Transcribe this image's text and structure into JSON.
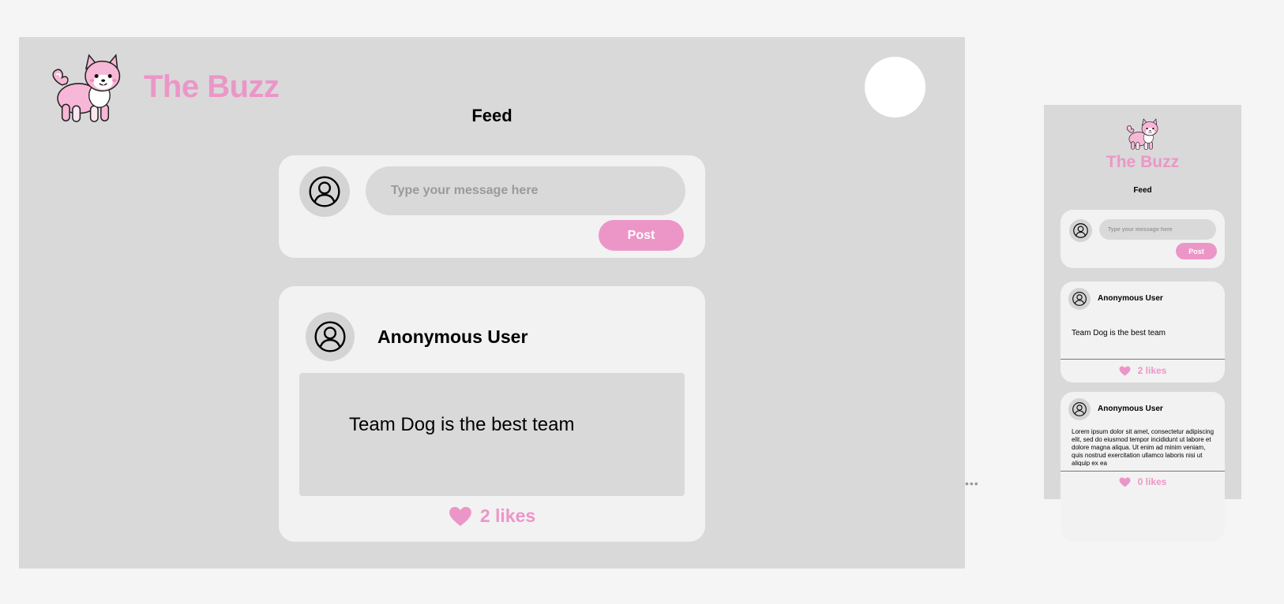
{
  "app": {
    "title": "The Buzz",
    "feed_heading": "Feed",
    "brand_color": "#ec96c8",
    "logo_icon": "shiba-dog-logo"
  },
  "compose": {
    "placeholder": "Type your message here",
    "post_label": "Post",
    "avatar_icon": "user-circle-icon"
  },
  "desktop_posts": [
    {
      "user": "Anonymous User",
      "text": "Team Dog is the best team",
      "likes_label": "2 likes",
      "like_icon": "heart-icon"
    }
  ],
  "mobile_posts": [
    {
      "user": "Anonymous User",
      "text": "Team Dog is the best team",
      "likes_label": "2 likes"
    },
    {
      "user": "Anonymous User",
      "text": "Lorem ipsum dolor sit amet, consectetur adipiscing elit, sed do eiusmod tempor incididunt ut labore et dolore magna aliqua. Ut enim ad minim veniam, quis nostrud exercitation ullamco laboris nisi ut aliquip ex ea",
      "likes_label": "0 likes"
    }
  ],
  "misc": {
    "more_dots": "•••"
  }
}
